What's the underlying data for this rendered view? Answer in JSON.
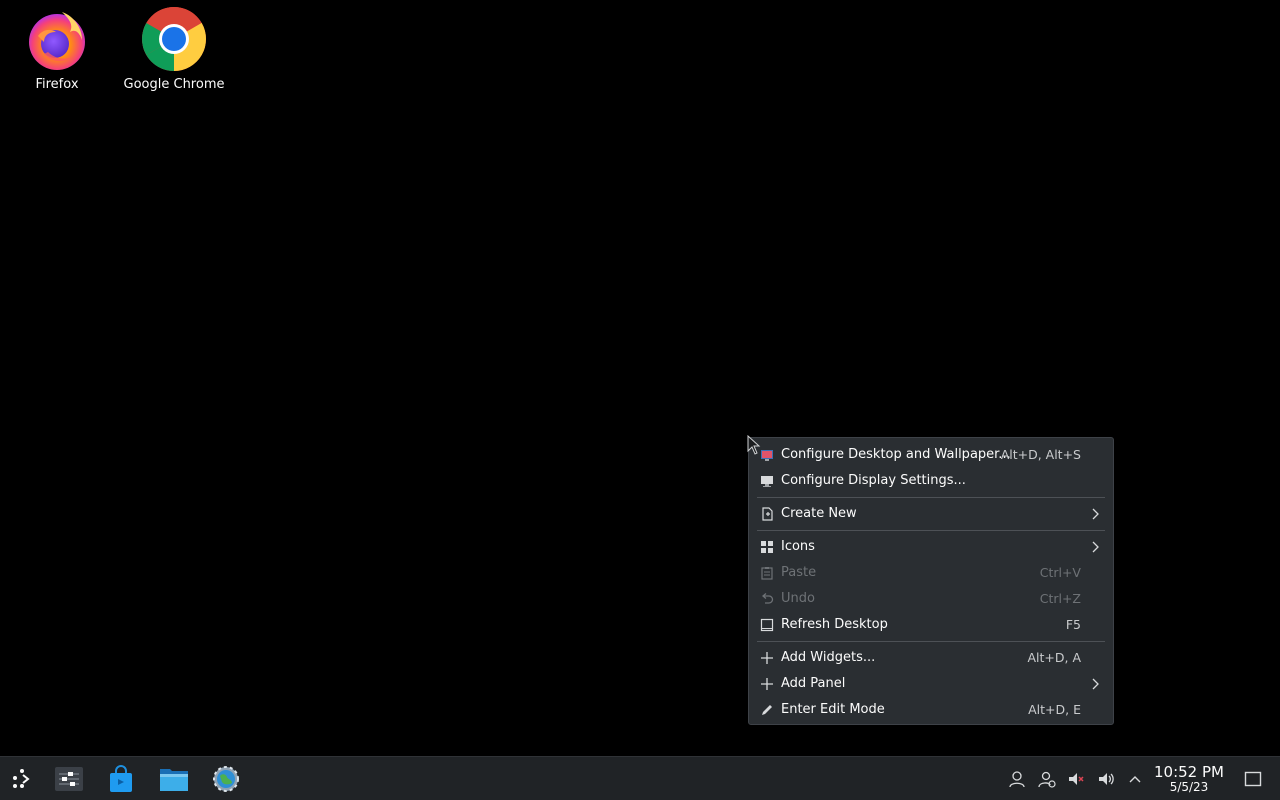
{
  "desktop": {
    "icons": [
      {
        "label": "Firefox",
        "icon": "firefox-icon"
      },
      {
        "label": "Google Chrome",
        "icon": "chrome-icon"
      }
    ]
  },
  "context_menu": {
    "items": [
      {
        "label": "Configure Desktop and Wallpaper...",
        "shortcut": "Alt+D, Alt+S",
        "icon": "desktop-wallpaper-icon"
      },
      {
        "label": "Configure Display Settings...",
        "shortcut": "",
        "icon": "display-icon"
      },
      {
        "label": "Create New",
        "icon": "new-document-icon",
        "submenu": true
      },
      {
        "label": "Icons",
        "icon": "grid-icon",
        "submenu": true
      },
      {
        "label": "Paste",
        "shortcut": "Ctrl+V",
        "icon": "clipboard-icon",
        "disabled": true
      },
      {
        "label": "Undo",
        "shortcut": "Ctrl+Z",
        "icon": "undo-icon",
        "disabled": true
      },
      {
        "label": "Refresh Desktop",
        "shortcut": "F5",
        "icon": "refresh-desktop-icon"
      },
      {
        "label": "Add Widgets...",
        "shortcut": "Alt+D, A",
        "icon": "plus-icon"
      },
      {
        "label": "Add Panel",
        "icon": "plus-icon",
        "submenu": true
      },
      {
        "label": "Enter Edit Mode",
        "shortcut": "Alt+D, E",
        "icon": "pencil-icon"
      }
    ]
  },
  "taskbar": {
    "launchers": [
      "application-launcher-icon",
      "system-monitor-icon",
      "discover-store-icon",
      "file-manager-icon",
      "system-settings-icon"
    ],
    "tray": [
      "user-icon",
      "user-switch-icon",
      "network-muted-icon",
      "volume-icon",
      "expand-tray-icon"
    ],
    "clock": {
      "time": "10:52 PM",
      "date": "5/5/23"
    }
  },
  "colors": {
    "menu_bg": "#2a2e32",
    "taskbar_bg": "#202326",
    "text": "#fcfcfc",
    "disabled_text": "#6e7276"
  }
}
